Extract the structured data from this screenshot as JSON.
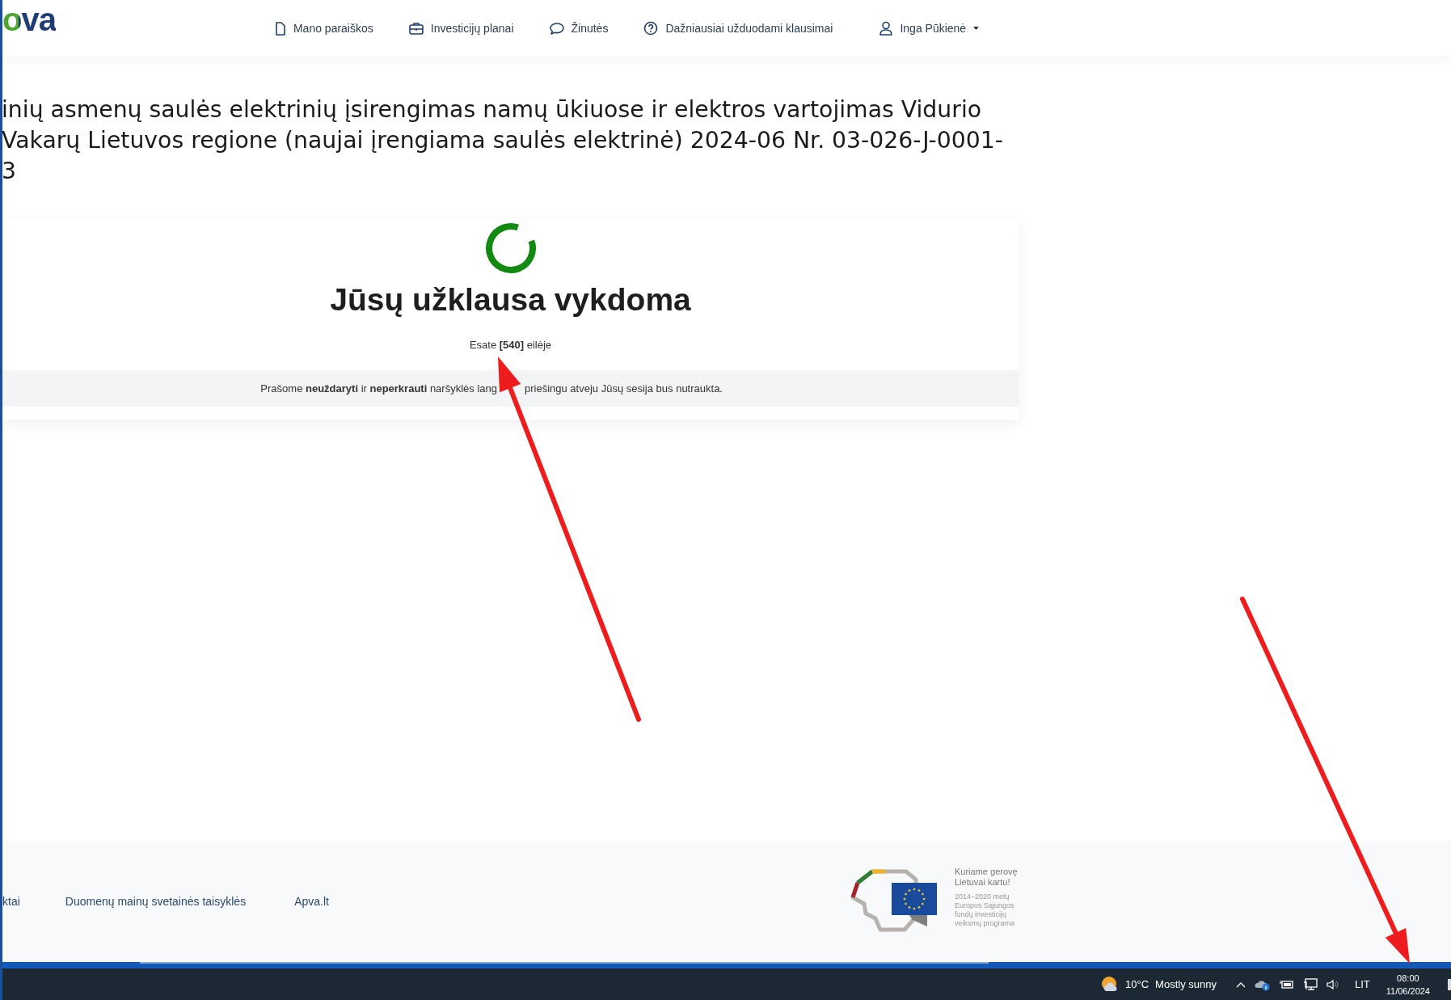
{
  "header": {
    "logo": "ova",
    "nav": [
      {
        "label": "Mano paraiškos"
      },
      {
        "label": "Investicijų planai"
      },
      {
        "label": "Žinutės"
      },
      {
        "label": "Dažniausiai užduodami klausimai"
      }
    ],
    "user": {
      "name": "Inga Pūkienė"
    }
  },
  "title_lines": [
    "inių asmenų saulės elektrinių įsirengimas namų ūkiuose ir elektros vartojimas Vidurio",
    "Vakarų Lietuvos regione (naujai įrengiama saulės elektrinė) 2024-06 Nr. 03-026-J-0001-",
    "3"
  ],
  "status_card": {
    "heading": "Jūsų užklausa vykdoma",
    "queue_text": "Esate **[540]** eilėje",
    "notice": [
      "Prašome **neuždaryti** ir **neperkrauti** naršyklės lang",
      "priešingu atveju Jūsų sesija bus nutraukta."
    ]
  },
  "footer": {
    "links": [
      "ktai",
      "Duomenų mainų svetainės taisyklės",
      "Apva.lt"
    ],
    "slogan": [
      "Kuriame gerovę",
      "Lietuvai kartu!"
    ],
    "program": [
      "2014–2020 metų",
      "Europos Sąjungos",
      "fondų investicijų",
      "veiksmų programa"
    ]
  },
  "taskbar": {
    "temperature": "10°C",
    "weather": "Mostly sunny",
    "language": "LIT",
    "time": "08:00",
    "date": "11/06/2024"
  }
}
